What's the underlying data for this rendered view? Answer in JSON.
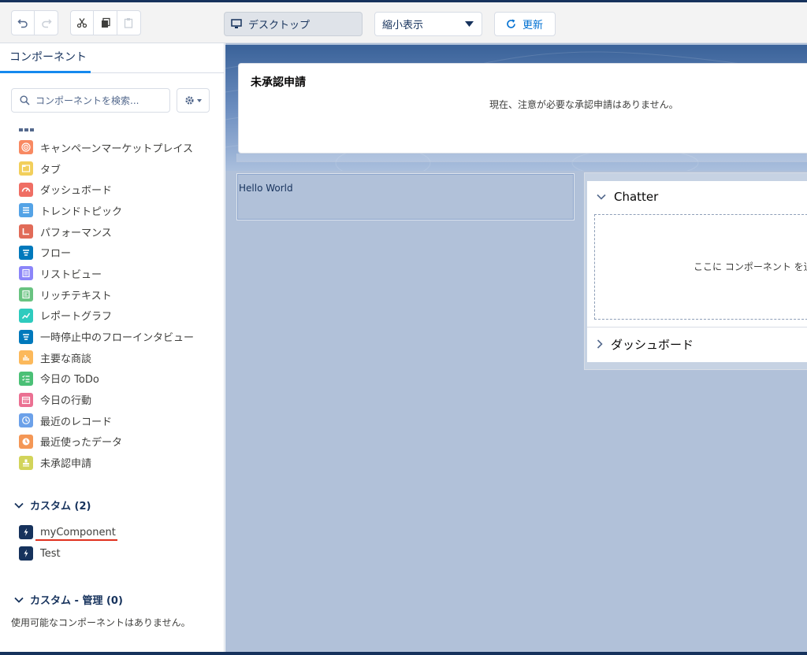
{
  "toolbar": {
    "device_label": "デスクトップ",
    "zoom_value": "縮小表示",
    "refresh_label": "更新"
  },
  "left_panel": {
    "tab_label": "コンポーネント",
    "search_placeholder": "コンポーネントを検索...",
    "standard_items": [
      {
        "label": "キャンペーンマーケットプレイス",
        "icon": "target-icon",
        "color": "#f88962"
      },
      {
        "label": "タブ",
        "icon": "tabset-icon",
        "color": "#f2cf5b"
      },
      {
        "label": "ダッシュボード",
        "icon": "dashboard-icon",
        "color": "#ef6e64"
      },
      {
        "label": "トレンドトピック",
        "icon": "list-icon",
        "color": "#54a3e6"
      },
      {
        "label": "パフォーマンス",
        "icon": "performance-icon",
        "color": "#e16b58"
      },
      {
        "label": "フロー",
        "icon": "flow-icon",
        "color": "#0079bc"
      },
      {
        "label": "リストビュー",
        "icon": "list-view-icon",
        "color": "#8b85f9"
      },
      {
        "label": "リッチテキスト",
        "icon": "rich-text-icon",
        "color": "#69c381"
      },
      {
        "label": "レポートグラフ",
        "icon": "report-chart-icon",
        "color": "#2ecbbe"
      },
      {
        "label": "一時停止中のフローインタビュー",
        "icon": "flow-icon",
        "color": "#0079bc"
      },
      {
        "label": "主要な商談",
        "icon": "bar-chart-icon",
        "color": "#fcb95b"
      },
      {
        "label": "今日の ToDo",
        "icon": "task-icon",
        "color": "#4bc076"
      },
      {
        "label": "今日の行動",
        "icon": "calendar-icon",
        "color": "#eb7092"
      },
      {
        "label": "最近のレコード",
        "icon": "recent-icon",
        "color": "#6ca1e9"
      },
      {
        "label": "最近使ったデータ",
        "icon": "clock-icon",
        "color": "#f49756"
      },
      {
        "label": "未承認申請",
        "icon": "approval-icon",
        "color": "#d2d45a"
      }
    ],
    "custom_section": {
      "title": "カスタム (2)",
      "items": [
        {
          "label": "myComponent",
          "icon": "lightning-icon",
          "color": "#16325c"
        },
        {
          "label": "Test",
          "icon": "lightning-icon",
          "color": "#16325c"
        }
      ]
    },
    "managed_section": {
      "title": "カスタム - 管理 (0)",
      "empty_text": "使用可能なコンポーネントはありません。"
    }
  },
  "canvas": {
    "pending": {
      "title": "未承認申請",
      "message": "現在、注意が必要な承認申請はありません。"
    },
    "hello": {
      "text": "Hello World"
    },
    "tabs": {
      "chatter_label": "Chatter",
      "drop_hint": "ここに コンポーネント を追",
      "dashboard_label": "ダッシュボード"
    }
  }
}
